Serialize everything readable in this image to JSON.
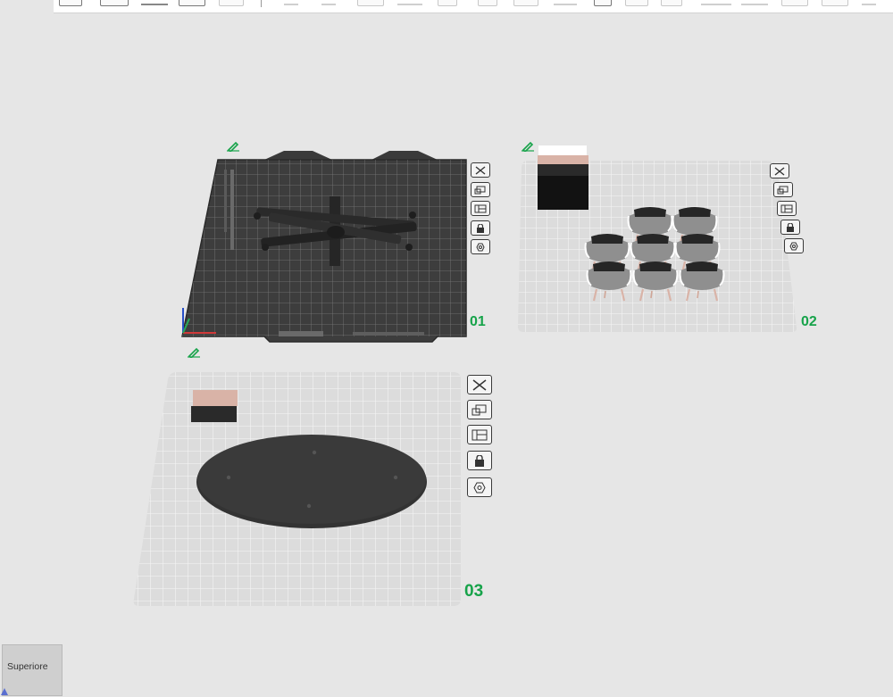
{
  "toolbar": {
    "icons": [
      "add-object-icon",
      "cut-icon",
      "arrange-icon",
      "orient-icon",
      "plate-icon",
      "split-icon",
      "support-icon",
      "seam-icon",
      "measure-icon",
      "text-icon",
      "assembly-icon",
      "variable-layer-icon",
      "scale-icon",
      "layers-icon",
      "drop-icon"
    ]
  },
  "plates": [
    {
      "label": "01",
      "type": "textured-pei"
    },
    {
      "label": "02",
      "type": "default"
    },
    {
      "label": "03",
      "type": "default"
    }
  ],
  "plate_tools": [
    "close-icon",
    "auto-orient-icon",
    "arrange-icon",
    "lock-icon",
    "settings-icon"
  ],
  "view_cube": {
    "label": "Superiore"
  },
  "colors": {
    "accent_green": "#17a34a",
    "plate_dark": "#3d3d3d",
    "plate_light": "#dcdcdc",
    "object_dark": "#2e2e2e",
    "object_pink": "#d9b3a7"
  }
}
